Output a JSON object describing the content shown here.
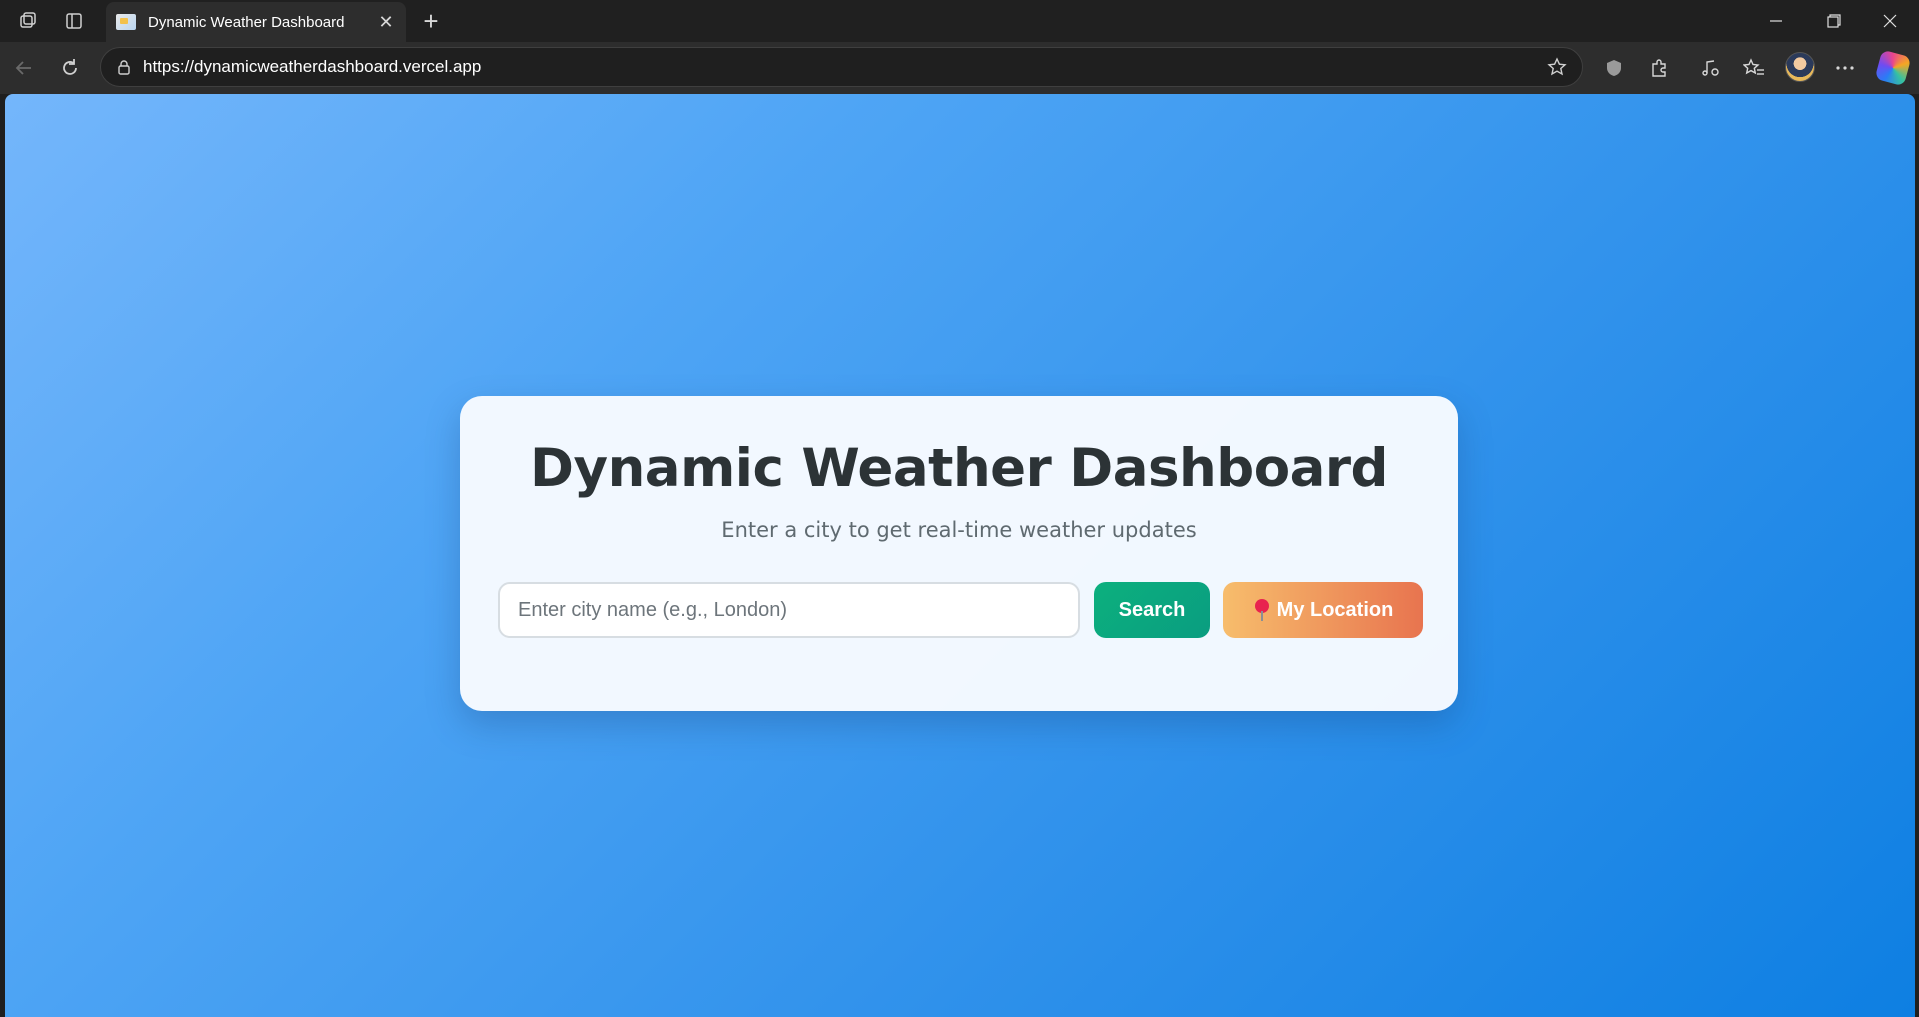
{
  "browser": {
    "tab_title": "Dynamic Weather Dashboard",
    "url": "https://dynamicweatherdashboard.vercel.app"
  },
  "page": {
    "title": "Dynamic Weather Dashboard",
    "subtitle": "Enter a city to get real-time weather updates",
    "search": {
      "placeholder": "Enter city name (e.g., London)",
      "value": "",
      "button_label": "Search"
    },
    "location_button_label": "My Location",
    "location_button_icon": "pin-icon"
  },
  "colors": {
    "background_start": "#74b6fb",
    "background_end": "#0e7fe2",
    "search_button": "#0cb07e",
    "location_button_start": "#f7bd6c",
    "location_button_end": "#e8744f",
    "title_text": "#2c3336"
  }
}
